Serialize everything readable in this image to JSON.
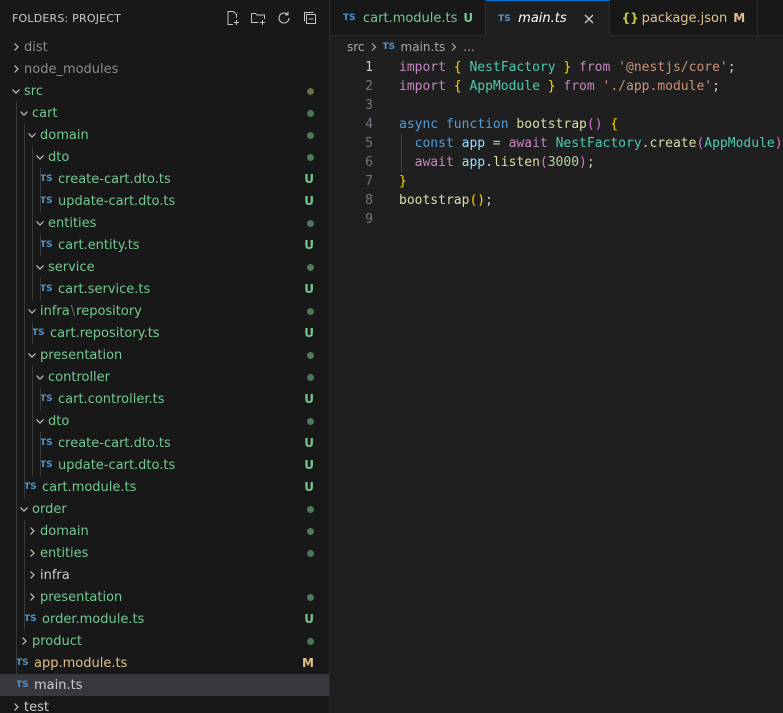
{
  "explorer": {
    "title": "FOLDERS: PROJECT",
    "actions": [
      "new-file-icon",
      "new-folder-icon",
      "refresh-icon",
      "collapse-all-icon"
    ]
  },
  "tree": [
    {
      "label": "dist",
      "kind": "folder",
      "open": false,
      "depth": 0,
      "color": "dim",
      "status": ""
    },
    {
      "label": "node_modules",
      "kind": "folder",
      "open": false,
      "depth": 0,
      "color": "dim",
      "status": ""
    },
    {
      "label": "src",
      "kind": "folder",
      "open": true,
      "depth": 0,
      "color": "green",
      "status": "dot-dark"
    },
    {
      "label": "cart",
      "kind": "folder",
      "open": true,
      "depth": 1,
      "color": "green",
      "status": "dot"
    },
    {
      "label": "domain",
      "kind": "folder",
      "open": true,
      "depth": 2,
      "color": "green",
      "status": "dot"
    },
    {
      "label": "dto",
      "kind": "folder",
      "open": true,
      "depth": 3,
      "color": "green",
      "status": "dot"
    },
    {
      "label": "create-cart.dto.ts",
      "kind": "ts",
      "depth": 4,
      "color": "green",
      "status": "U"
    },
    {
      "label": "update-cart.dto.ts",
      "kind": "ts",
      "depth": 4,
      "color": "green",
      "status": "U"
    },
    {
      "label": "entities",
      "kind": "folder",
      "open": true,
      "depth": 3,
      "color": "green",
      "status": "dot"
    },
    {
      "label": "cart.entity.ts",
      "kind": "ts",
      "depth": 4,
      "color": "green",
      "status": "U"
    },
    {
      "label": "service",
      "kind": "folder",
      "open": true,
      "depth": 3,
      "color": "green",
      "status": "dot"
    },
    {
      "label": "cart.service.ts",
      "kind": "ts",
      "depth": 4,
      "color": "green",
      "status": "U"
    },
    {
      "label": "infra",
      "label2": "repository",
      "kind": "folder",
      "open": true,
      "depth": 2,
      "color": "green",
      "status": "dot"
    },
    {
      "label": "cart.repository.ts",
      "kind": "ts",
      "depth": 3,
      "color": "green",
      "status": "U"
    },
    {
      "label": "presentation",
      "kind": "folder",
      "open": true,
      "depth": 2,
      "color": "green",
      "status": "dot"
    },
    {
      "label": "controller",
      "kind": "folder",
      "open": true,
      "depth": 3,
      "color": "green",
      "status": "dot"
    },
    {
      "label": "cart.controller.ts",
      "kind": "ts",
      "depth": 4,
      "color": "green",
      "status": "U"
    },
    {
      "label": "dto",
      "kind": "folder",
      "open": true,
      "depth": 3,
      "color": "green",
      "status": "dot"
    },
    {
      "label": "create-cart.dto.ts",
      "kind": "ts",
      "depth": 4,
      "color": "green",
      "status": "U"
    },
    {
      "label": "update-cart.dto.ts",
      "kind": "ts",
      "depth": 4,
      "color": "green",
      "status": "U"
    },
    {
      "label": "cart.module.ts",
      "kind": "ts",
      "depth": 2,
      "color": "green",
      "status": "U"
    },
    {
      "label": "order",
      "kind": "folder",
      "open": true,
      "depth": 1,
      "color": "green",
      "status": "dot"
    },
    {
      "label": "domain",
      "kind": "folder",
      "open": false,
      "depth": 2,
      "color": "green",
      "status": "dot"
    },
    {
      "label": "entities",
      "kind": "folder",
      "open": false,
      "depth": 2,
      "color": "green",
      "status": "dot"
    },
    {
      "label": "infra",
      "kind": "folder",
      "open": false,
      "depth": 2,
      "color": "plain",
      "status": ""
    },
    {
      "label": "presentation",
      "kind": "folder",
      "open": false,
      "depth": 2,
      "color": "green",
      "status": "dot"
    },
    {
      "label": "order.module.ts",
      "kind": "ts",
      "depth": 2,
      "color": "green",
      "status": "U"
    },
    {
      "label": "product",
      "kind": "folder",
      "open": false,
      "depth": 1,
      "color": "green",
      "status": "dot"
    },
    {
      "label": "app.module.ts",
      "kind": "ts",
      "depth": 1,
      "color": "yellow",
      "status": "M"
    },
    {
      "label": "main.ts",
      "kind": "ts",
      "depth": 1,
      "color": "plain",
      "status": "",
      "selected": true
    },
    {
      "label": "test",
      "kind": "folder",
      "open": false,
      "depth": 0,
      "color": "plain",
      "status": ""
    }
  ],
  "tabs": [
    {
      "badge": "TS",
      "label": "cart.module.ts",
      "status": "U",
      "color": "green",
      "active": false
    },
    {
      "badge": "TS",
      "label": "main.ts",
      "status": "",
      "color": "active-label",
      "active": true
    },
    {
      "badge": "{}",
      "label": "package.json",
      "status": "M",
      "color": "yellow",
      "active": false
    }
  ],
  "breadcrumb": {
    "folder": "src",
    "file_badge": "TS",
    "file": "main.ts",
    "more": "..."
  },
  "code": {
    "line_numbers": [
      "1",
      "2",
      "3",
      "4",
      "5",
      "6",
      "7",
      "8",
      "9"
    ],
    "current_line": 1,
    "lines": [
      [
        [
          "kw2",
          "import"
        ],
        [
          "punc",
          " "
        ],
        [
          "brace",
          "{"
        ],
        [
          "punc",
          " "
        ],
        [
          "cls",
          "NestFactory"
        ],
        [
          "punc",
          " "
        ],
        [
          "brace",
          "}"
        ],
        [
          "punc",
          " "
        ],
        [
          "kw2",
          "from"
        ],
        [
          "punc",
          " "
        ],
        [
          "str",
          "'@nestjs/core'"
        ],
        [
          "punc",
          ";"
        ]
      ],
      [
        [
          "kw2",
          "import"
        ],
        [
          "punc",
          " "
        ],
        [
          "brace",
          "{"
        ],
        [
          "punc",
          " "
        ],
        [
          "cls",
          "AppModule"
        ],
        [
          "punc",
          " "
        ],
        [
          "brace",
          "}"
        ],
        [
          "punc",
          " "
        ],
        [
          "kw2",
          "from"
        ],
        [
          "punc",
          " "
        ],
        [
          "str",
          "'./app.module'"
        ],
        [
          "punc",
          ";"
        ]
      ],
      [],
      [
        [
          "kw",
          "async"
        ],
        [
          "punc",
          " "
        ],
        [
          "kw",
          "function"
        ],
        [
          "punc",
          " "
        ],
        [
          "fn",
          "bootstrap"
        ],
        [
          "paren",
          "()"
        ],
        [
          "punc",
          " "
        ],
        [
          "brace",
          "{"
        ]
      ],
      [
        [
          "punc",
          "  "
        ],
        [
          "kw",
          "const"
        ],
        [
          "punc",
          " "
        ],
        [
          "var",
          "app"
        ],
        [
          "punc",
          " = "
        ],
        [
          "kw2",
          "await"
        ],
        [
          "punc",
          " "
        ],
        [
          "cls",
          "NestFactory"
        ],
        [
          "punc",
          "."
        ],
        [
          "fn",
          "create"
        ],
        [
          "paren",
          "("
        ],
        [
          "cls",
          "AppModule"
        ],
        [
          "paren",
          ")"
        ],
        [
          "punc",
          ";"
        ]
      ],
      [
        [
          "punc",
          "  "
        ],
        [
          "kw2",
          "await"
        ],
        [
          "punc",
          " "
        ],
        [
          "var",
          "app"
        ],
        [
          "punc",
          "."
        ],
        [
          "fn",
          "listen"
        ],
        [
          "paren",
          "("
        ],
        [
          "num",
          "3000"
        ],
        [
          "paren",
          ")"
        ],
        [
          "punc",
          ";"
        ]
      ],
      [
        [
          "brace",
          "}"
        ]
      ],
      [
        [
          "fn",
          "bootstrap"
        ],
        [
          "brace",
          "()"
        ],
        [
          "punc",
          ";"
        ]
      ],
      []
    ]
  }
}
